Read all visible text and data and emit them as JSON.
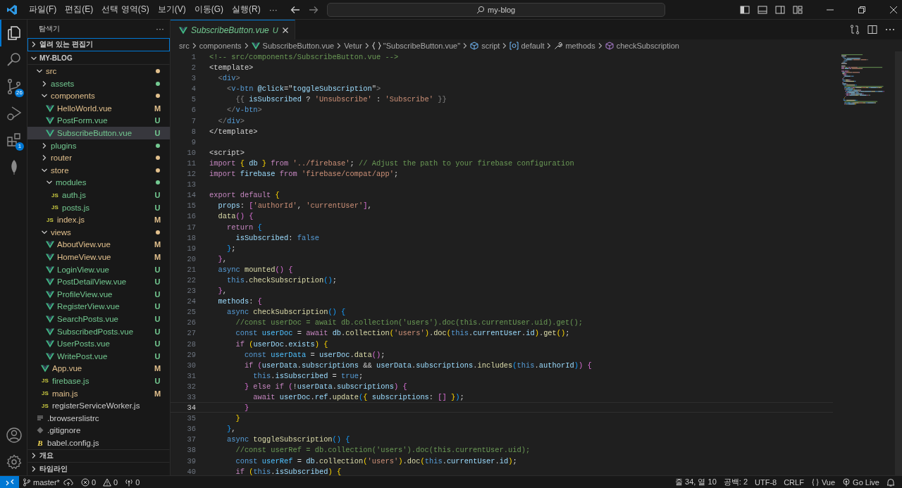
{
  "title_bar": {
    "menu": [
      "파일(F)",
      "편집(E)",
      "선택 영역(S)",
      "보기(V)",
      "이동(G)",
      "실행(R)",
      "···"
    ],
    "search": {
      "value": "my-blog"
    }
  },
  "activity_bar": {
    "items": [
      {
        "kind": "explorer",
        "selected": true
      },
      {
        "kind": "search",
        "selected": false
      },
      {
        "kind": "source-control",
        "selected": false,
        "badge": "26"
      },
      {
        "kind": "run-debug",
        "selected": false
      },
      {
        "kind": "extensions",
        "selected": false,
        "badge": "1"
      },
      {
        "kind": "leaf",
        "selected": false
      }
    ],
    "bottom": [
      {
        "kind": "account"
      },
      {
        "kind": "settings"
      }
    ]
  },
  "sidebar": {
    "title": "탐색기",
    "more": "···",
    "open_editors": {
      "label": "열려 있는 편집기",
      "expanded": false,
      "focused": true
    },
    "root": {
      "label": "MY-BLOG",
      "expanded": true
    },
    "tree": [
      {
        "name": "src",
        "kind": "folder",
        "expanded": true,
        "selected": false,
        "color": "#e2c08d",
        "children": [
          {
            "name": "assets",
            "kind": "folder",
            "expanded": false,
            "selected": false,
            "color": "#73c991"
          },
          {
            "name": "components",
            "kind": "folder",
            "expanded": true,
            "selected": false,
            "color": "#e2c08d",
            "children": [
              {
                "name": "HelloWorld.vue",
                "kind": "vue",
                "status": "M",
                "selected": false,
                "color": "#e2c08d"
              },
              {
                "name": "PostForm.vue",
                "kind": "vue",
                "status": "U",
                "selected": false,
                "color": "#73c991"
              },
              {
                "name": "SubscribeButton.vue",
                "kind": "vue",
                "status": "U",
                "selected": true,
                "color": "#73c991"
              }
            ]
          },
          {
            "name": "plugins",
            "kind": "folder",
            "expanded": false,
            "selected": false,
            "color": "#73c991"
          },
          {
            "name": "router",
            "kind": "folder",
            "expanded": false,
            "selected": false,
            "color": "#e2c08d"
          },
          {
            "name": "store",
            "kind": "folder",
            "expanded": true,
            "selected": false,
            "color": "#e2c08d",
            "children": [
              {
                "name": "modules",
                "kind": "folder",
                "expanded": true,
                "selected": false,
                "color": "#73c991",
                "children": [
                  {
                    "name": "auth.js",
                    "kind": "js",
                    "icon": "JS",
                    "status": "U",
                    "selected": false,
                    "color": "#73c991"
                  },
                  {
                    "name": "posts.js",
                    "kind": "js",
                    "icon": "JS",
                    "status": "U",
                    "selected": false,
                    "color": "#73c991"
                  }
                ]
              },
              {
                "name": "index.js",
                "kind": "js",
                "icon": "JS",
                "status": "M",
                "selected": false,
                "color": "#e2c08d"
              }
            ]
          },
          {
            "name": "views",
            "kind": "folder",
            "expanded": true,
            "selected": false,
            "color": "#e2c08d",
            "children": [
              {
                "name": "AboutView.vue",
                "kind": "vue",
                "status": "M",
                "selected": false,
                "color": "#e2c08d"
              },
              {
                "name": "HomeView.vue",
                "kind": "vue",
                "status": "M",
                "selected": false,
                "color": "#e2c08d"
              },
              {
                "name": "LoginView.vue",
                "kind": "vue",
                "status": "U",
                "selected": false,
                "color": "#73c991"
              },
              {
                "name": "PostDetailView.vue",
                "kind": "vue",
                "status": "U",
                "selected": false,
                "color": "#73c991"
              },
              {
                "name": "ProfileView.vue",
                "kind": "vue",
                "status": "U",
                "selected": false,
                "color": "#73c991"
              },
              {
                "name": "RegisterView.vue",
                "kind": "vue",
                "status": "U",
                "selected": false,
                "color": "#73c991"
              },
              {
                "name": "SearchPosts.vue",
                "kind": "vue",
                "status": "U",
                "selected": false,
                "color": "#73c991"
              },
              {
                "name": "SubscribedPosts.vue",
                "kind": "vue",
                "status": "U",
                "selected": false,
                "color": "#73c991"
              },
              {
                "name": "UserPosts.vue",
                "kind": "vue",
                "status": "U",
                "selected": false,
                "color": "#73c991"
              },
              {
                "name": "WritePost.vue",
                "kind": "vue",
                "status": "U",
                "selected": false,
                "color": "#73c991"
              }
            ]
          },
          {
            "name": "App.vue",
            "kind": "vue",
            "status": "M",
            "selected": false,
            "color": "#e2c08d"
          },
          {
            "name": "firebase.js",
            "kind": "js",
            "icon": "JS",
            "status": "U",
            "selected": false,
            "color": "#73c991"
          },
          {
            "name": "main.js",
            "kind": "js",
            "icon": "JS",
            "status": "M",
            "selected": false,
            "color": "#e2c08d"
          },
          {
            "name": "registerServiceWorker.js",
            "kind": "js",
            "icon": "JS",
            "selected": false
          }
        ]
      },
      {
        "name": ".browserslistrc",
        "kind": "config",
        "selected": false
      },
      {
        "name": ".gitignore",
        "kind": "git",
        "selected": false
      },
      {
        "name": "babel.config.js",
        "kind": "babel",
        "icon": "B",
        "selected": false
      }
    ],
    "sections": [
      {
        "label": "개요",
        "expanded": false
      },
      {
        "label": "타임라인",
        "expanded": false
      }
    ]
  },
  "tabs": [
    {
      "label": "SubscribeButton.vue",
      "status": "U",
      "selected": true,
      "preview": true
    }
  ],
  "breadcrumbs": [
    {
      "kind": "folder",
      "text": "src"
    },
    {
      "kind": "folder",
      "text": "components"
    },
    {
      "kind": "vue",
      "text": "SubscribeButton.vue"
    },
    {
      "kind": "folder",
      "text": "Vetur"
    },
    {
      "kind": "braces",
      "text": "\"SubscribeButton.vue\""
    },
    {
      "kind": "cube",
      "text": "script"
    },
    {
      "kind": "module",
      "text": "default"
    },
    {
      "kind": "wrench",
      "text": "methods"
    },
    {
      "kind": "method",
      "text": "checkSubscription"
    }
  ],
  "editor": {
    "lines": [
      {
        "number": "1",
        "current": false,
        "tokens": [
          {
            "kind": "com",
            "text": "<!-- src/components/SubscribeButton.vue -->"
          }
        ]
      },
      {
        "number": "2",
        "current": false,
        "tokens": [
          {
            "kind": "plain",
            "text": "<template>"
          }
        ]
      },
      {
        "number": "3",
        "current": false,
        "tokens": [
          {
            "kind": "tagp",
            "text": "  <"
          },
          {
            "kind": "tag",
            "text": "div"
          },
          {
            "kind": "tagp",
            "text": ">"
          }
        ]
      },
      {
        "number": "4",
        "current": false,
        "tokens": [
          {
            "kind": "tagp",
            "text": "    <"
          },
          {
            "kind": "tag",
            "text": "v-btn"
          },
          {
            "kind": "var",
            "text": " @click"
          },
          {
            "kind": "plain",
            "text": "=\""
          },
          {
            "kind": "var",
            "text": "toggleSubscription"
          },
          {
            "kind": "plain",
            "text": "\""
          },
          {
            "kind": "tagp",
            "text": ">"
          }
        ]
      },
      {
        "number": "5",
        "current": false,
        "tokens": [
          {
            "kind": "tagp",
            "text": "      {{"
          },
          {
            "kind": "var",
            "text": " isSubscribed"
          },
          {
            "kind": "plain",
            "text": " ? "
          },
          {
            "kind": "str",
            "text": "'Unsubscribe'"
          },
          {
            "kind": "plain",
            "text": " : "
          },
          {
            "kind": "str",
            "text": "'Subscribe'"
          },
          {
            "kind": "tagp",
            "text": " }}"
          }
        ]
      },
      {
        "number": "6",
        "current": false,
        "tokens": [
          {
            "kind": "tagp",
            "text": "    </"
          },
          {
            "kind": "tag",
            "text": "v-btn"
          },
          {
            "kind": "tagp",
            "text": ">"
          }
        ]
      },
      {
        "number": "7",
        "current": false,
        "tokens": [
          {
            "kind": "tagp",
            "text": "  </"
          },
          {
            "kind": "tag",
            "text": "div"
          },
          {
            "kind": "tagp",
            "text": ">"
          }
        ]
      },
      {
        "number": "8",
        "current": false,
        "tokens": [
          {
            "kind": "plain",
            "text": "</template>"
          }
        ]
      },
      {
        "number": "9",
        "current": false
      },
      {
        "number": "10",
        "current": false,
        "tokens": [
          {
            "kind": "plain",
            "text": "<script>"
          }
        ]
      },
      {
        "number": "11",
        "current": false,
        "tokens": [
          {
            "kind": "kw",
            "text": "import"
          },
          {
            "kind": "b1",
            "text": " {"
          },
          {
            "kind": "var",
            "text": " db"
          },
          {
            "kind": "b1",
            "text": " }"
          },
          {
            "kind": "kw",
            "text": " from"
          },
          {
            "kind": "str",
            "text": " '../firebase'"
          },
          {
            "kind": "plain",
            "text": "; "
          },
          {
            "kind": "com",
            "text": "// Adjust the path to your firebase configuration"
          }
        ]
      },
      {
        "number": "12",
        "current": false,
        "tokens": [
          {
            "kind": "kw",
            "text": "import"
          },
          {
            "kind": "var",
            "text": " firebase"
          },
          {
            "kind": "kw",
            "text": " from"
          },
          {
            "kind": "str",
            "text": " 'firebase/compat/app'"
          },
          {
            "kind": "plain",
            "text": ";"
          }
        ]
      },
      {
        "number": "13",
        "current": false
      },
      {
        "number": "14",
        "current": false,
        "tokens": [
          {
            "kind": "kw",
            "text": "export"
          },
          {
            "kind": "kw",
            "text": " default"
          },
          {
            "kind": "b1",
            "text": " {"
          }
        ]
      },
      {
        "number": "15",
        "current": false,
        "tokens": [
          {
            "kind": "var",
            "text": "  props"
          },
          {
            "kind": "plain",
            "text": ": "
          },
          {
            "kind": "b2",
            "text": "["
          },
          {
            "kind": "str",
            "text": "'authorId'"
          },
          {
            "kind": "plain",
            "text": ", "
          },
          {
            "kind": "str",
            "text": "'currentUser'"
          },
          {
            "kind": "b2",
            "text": "]"
          },
          {
            "kind": "plain",
            "text": ","
          }
        ]
      },
      {
        "number": "16",
        "current": false,
        "tokens": [
          {
            "kind": "fn",
            "text": "  data"
          },
          {
            "kind": "b2",
            "text": "()"
          },
          {
            "kind": "b2",
            "text": " {"
          }
        ]
      },
      {
        "number": "17",
        "current": false,
        "tokens": [
          {
            "kind": "kw",
            "text": "    return"
          },
          {
            "kind": "b3",
            "text": " {"
          }
        ]
      },
      {
        "number": "18",
        "current": false,
        "tokens": [
          {
            "kind": "var",
            "text": "      isSubscribed"
          },
          {
            "kind": "plain",
            "text": ": "
          },
          {
            "kind": "st",
            "text": "false"
          }
        ]
      },
      {
        "number": "19",
        "current": false,
        "tokens": [
          {
            "kind": "b3",
            "text": "    }"
          },
          {
            "kind": "plain",
            "text": ";"
          }
        ]
      },
      {
        "number": "20",
        "current": false,
        "tokens": [
          {
            "kind": "b2",
            "text": "  }"
          },
          {
            "kind": "plain",
            "text": ","
          }
        ]
      },
      {
        "number": "21",
        "current": false,
        "tokens": [
          {
            "kind": "st",
            "text": "  async"
          },
          {
            "kind": "fn",
            "text": " mounted"
          },
          {
            "kind": "b2",
            "text": "()"
          },
          {
            "kind": "b2",
            "text": " {"
          }
        ]
      },
      {
        "number": "22",
        "current": false,
        "tokens": [
          {
            "kind": "st",
            "text": "    this"
          },
          {
            "kind": "plain",
            "text": "."
          },
          {
            "kind": "fn",
            "text": "checkSubscription"
          },
          {
            "kind": "b3",
            "text": "()"
          },
          {
            "kind": "plain",
            "text": ";"
          }
        ]
      },
      {
        "number": "23",
        "current": false,
        "tokens": [
          {
            "kind": "b2",
            "text": "  }"
          },
          {
            "kind": "plain",
            "text": ","
          }
        ]
      },
      {
        "number": "24",
        "current": false,
        "tokens": [
          {
            "kind": "var",
            "text": "  methods"
          },
          {
            "kind": "plain",
            "text": ": "
          },
          {
            "kind": "b2",
            "text": "{"
          }
        ]
      },
      {
        "number": "25",
        "current": false,
        "tokens": [
          {
            "kind": "st",
            "text": "    async"
          },
          {
            "kind": "fn",
            "text": " checkSubscription"
          },
          {
            "kind": "b3",
            "text": "()"
          },
          {
            "kind": "b3",
            "text": " {"
          }
        ]
      },
      {
        "number": "26",
        "current": false,
        "tokens": [
          {
            "kind": "com",
            "text": "      //const userDoc = await db.collection('users').doc(this.currentUser.uid).get();"
          }
        ]
      },
      {
        "number": "27",
        "current": false,
        "tokens": [
          {
            "kind": "st",
            "text": "      const"
          },
          {
            "kind": "cv",
            "text": " userDoc"
          },
          {
            "kind": "plain",
            "text": " = "
          },
          {
            "kind": "kw",
            "text": "await"
          },
          {
            "kind": "var",
            "text": " db"
          },
          {
            "kind": "plain",
            "text": "."
          },
          {
            "kind": "fn",
            "text": "collection"
          },
          {
            "kind": "b1",
            "text": "("
          },
          {
            "kind": "str",
            "text": "'users'"
          },
          {
            "kind": "b1",
            "text": ")"
          },
          {
            "kind": "plain",
            "text": "."
          },
          {
            "kind": "fn",
            "text": "doc"
          },
          {
            "kind": "b1",
            "text": "("
          },
          {
            "kind": "st",
            "text": "this"
          },
          {
            "kind": "plain",
            "text": "."
          },
          {
            "kind": "var",
            "text": "currentUser"
          },
          {
            "kind": "plain",
            "text": "."
          },
          {
            "kind": "var",
            "text": "id"
          },
          {
            "kind": "b1",
            "text": ")"
          },
          {
            "kind": "plain",
            "text": "."
          },
          {
            "kind": "fn",
            "text": "get"
          },
          {
            "kind": "b1",
            "text": "()"
          },
          {
            "kind": "plain",
            "text": ";"
          }
        ]
      },
      {
        "number": "28",
        "current": false,
        "tokens": [
          {
            "kind": "kw",
            "text": "      if"
          },
          {
            "kind": "b1",
            "text": " ("
          },
          {
            "kind": "var",
            "text": "userDoc"
          },
          {
            "kind": "plain",
            "text": "."
          },
          {
            "kind": "var",
            "text": "exists"
          },
          {
            "kind": "b1",
            "text": ")"
          },
          {
            "kind": "b1",
            "text": " {"
          }
        ]
      },
      {
        "number": "29",
        "current": false,
        "tokens": [
          {
            "kind": "st",
            "text": "        const"
          },
          {
            "kind": "cv",
            "text": " userData"
          },
          {
            "kind": "plain",
            "text": " = "
          },
          {
            "kind": "var",
            "text": "userDoc"
          },
          {
            "kind": "plain",
            "text": "."
          },
          {
            "kind": "fn",
            "text": "data"
          },
          {
            "kind": "b2",
            "text": "()"
          },
          {
            "kind": "plain",
            "text": ";"
          }
        ]
      },
      {
        "number": "30",
        "current": false,
        "tokens": [
          {
            "kind": "kw",
            "text": "        if"
          },
          {
            "kind": "b2",
            "text": " ("
          },
          {
            "kind": "var",
            "text": "userData"
          },
          {
            "kind": "plain",
            "text": "."
          },
          {
            "kind": "var",
            "text": "subscriptions"
          },
          {
            "kind": "plain",
            "text": " && "
          },
          {
            "kind": "var",
            "text": "userData"
          },
          {
            "kind": "plain",
            "text": "."
          },
          {
            "kind": "var",
            "text": "subscriptions"
          },
          {
            "kind": "plain",
            "text": "."
          },
          {
            "kind": "fn",
            "text": "includes"
          },
          {
            "kind": "b3",
            "text": "("
          },
          {
            "kind": "st",
            "text": "this"
          },
          {
            "kind": "plain",
            "text": "."
          },
          {
            "kind": "var",
            "text": "authorId"
          },
          {
            "kind": "b3",
            "text": ")"
          },
          {
            "kind": "b2",
            "text": ")"
          },
          {
            "kind": "b2",
            "text": " {"
          }
        ]
      },
      {
        "number": "31",
        "current": false,
        "tokens": [
          {
            "kind": "st",
            "text": "          this"
          },
          {
            "kind": "plain",
            "text": "."
          },
          {
            "kind": "var",
            "text": "isSubscribed"
          },
          {
            "kind": "plain",
            "text": " = "
          },
          {
            "kind": "st",
            "text": "true"
          },
          {
            "kind": "plain",
            "text": ";"
          }
        ]
      },
      {
        "number": "32",
        "current": false,
        "tokens": [
          {
            "kind": "b2",
            "text": "        }"
          },
          {
            "kind": "kw",
            "text": " else"
          },
          {
            "kind": "kw",
            "text": " if"
          },
          {
            "kind": "b2",
            "text": " ("
          },
          {
            "kind": "plain",
            "text": "!"
          },
          {
            "kind": "var",
            "text": "userData"
          },
          {
            "kind": "plain",
            "text": "."
          },
          {
            "kind": "var",
            "text": "subscriptions"
          },
          {
            "kind": "b2",
            "text": ")"
          },
          {
            "kind": "b2",
            "text": " {"
          }
        ]
      },
      {
        "number": "33",
        "current": false,
        "tokens": [
          {
            "kind": "kw",
            "text": "          await"
          },
          {
            "kind": "var",
            "text": " userDoc"
          },
          {
            "kind": "plain",
            "text": "."
          },
          {
            "kind": "var",
            "text": "ref"
          },
          {
            "kind": "plain",
            "text": "."
          },
          {
            "kind": "fn",
            "text": "update"
          },
          {
            "kind": "b3",
            "text": "("
          },
          {
            "kind": "b1",
            "text": "{"
          },
          {
            "kind": "var",
            "text": " subscriptions"
          },
          {
            "kind": "plain",
            "text": ": "
          },
          {
            "kind": "b2",
            "text": "[]"
          },
          {
            "kind": "b1",
            "text": " }"
          },
          {
            "kind": "b3",
            "text": ")"
          },
          {
            "kind": "plain",
            "text": ";"
          }
        ]
      },
      {
        "number": "34",
        "current": true,
        "tokens": [
          {
            "kind": "b2",
            "text": "        }"
          }
        ]
      },
      {
        "number": "35",
        "current": false,
        "tokens": [
          {
            "kind": "b1",
            "text": "      }"
          }
        ]
      },
      {
        "number": "36",
        "current": false,
        "tokens": [
          {
            "kind": "b3",
            "text": "    }"
          },
          {
            "kind": "plain",
            "text": ","
          }
        ]
      },
      {
        "number": "37",
        "current": false,
        "tokens": [
          {
            "kind": "st",
            "text": "    async"
          },
          {
            "kind": "fn",
            "text": " toggleSubscription"
          },
          {
            "kind": "b3",
            "text": "()"
          },
          {
            "kind": "b3",
            "text": " {"
          }
        ]
      },
      {
        "number": "38",
        "current": false,
        "tokens": [
          {
            "kind": "com",
            "text": "      //const userRef = db.collection('users').doc(this.currentUser.uid);"
          }
        ]
      },
      {
        "number": "39",
        "current": false,
        "tokens": [
          {
            "kind": "st",
            "text": "      const"
          },
          {
            "kind": "cv",
            "text": " userRef"
          },
          {
            "kind": "plain",
            "text": " = "
          },
          {
            "kind": "var",
            "text": "db"
          },
          {
            "kind": "plain",
            "text": "."
          },
          {
            "kind": "fn",
            "text": "collection"
          },
          {
            "kind": "b1",
            "text": "("
          },
          {
            "kind": "str",
            "text": "'users'"
          },
          {
            "kind": "b1",
            "text": ")"
          },
          {
            "kind": "plain",
            "text": "."
          },
          {
            "kind": "fn",
            "text": "doc"
          },
          {
            "kind": "b1",
            "text": "("
          },
          {
            "kind": "st",
            "text": "this"
          },
          {
            "kind": "plain",
            "text": "."
          },
          {
            "kind": "var",
            "text": "currentUser"
          },
          {
            "kind": "plain",
            "text": "."
          },
          {
            "kind": "var",
            "text": "id"
          },
          {
            "kind": "b1",
            "text": ")"
          },
          {
            "kind": "plain",
            "text": ";"
          }
        ]
      },
      {
        "number": "40",
        "current": false,
        "tokens": [
          {
            "kind": "kw",
            "text": "      if"
          },
          {
            "kind": "b1",
            "text": " ("
          },
          {
            "kind": "st",
            "text": "this"
          },
          {
            "kind": "plain",
            "text": "."
          },
          {
            "kind": "var",
            "text": "isSubscribed"
          },
          {
            "kind": "b1",
            "text": ")"
          },
          {
            "kind": "b1",
            "text": " {"
          }
        ]
      }
    ]
  },
  "status_bar": {
    "left": [
      {
        "kind": "branch",
        "text": "master*"
      },
      {
        "kind": "errors",
        "text": "0"
      },
      {
        "kind": "warnings",
        "text": "0"
      },
      {
        "kind": "ports",
        "text": "0"
      }
    ],
    "right": [
      {
        "kind": "plain",
        "text": "줄 34, 열 10"
      },
      {
        "kind": "plain",
        "text": "공백: 2"
      },
      {
        "kind": "plain",
        "text": "UTF-8"
      },
      {
        "kind": "plain",
        "text": "CRLF"
      },
      {
        "kind": "language",
        "text": "Vue"
      },
      {
        "kind": "live",
        "text": "Go Live"
      }
    ]
  }
}
